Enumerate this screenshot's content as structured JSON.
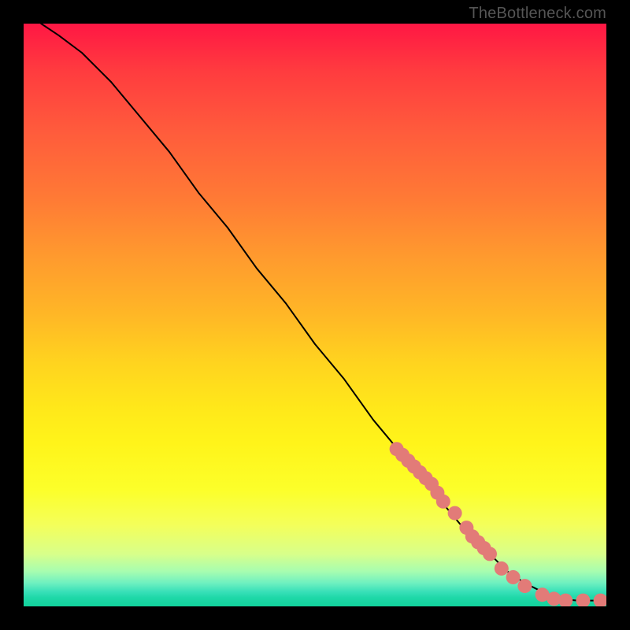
{
  "chart_data": {
    "type": "line",
    "title": "",
    "xlabel": "",
    "ylabel": "",
    "xlim": [
      0,
      100
    ],
    "ylim": [
      0,
      100
    ],
    "grid": false,
    "legend": false,
    "series": [
      {
        "name": "curve",
        "x": [
          3,
          6,
          10,
          15,
          20,
          25,
          30,
          35,
          40,
          45,
          50,
          55,
          60,
          65,
          70,
          75,
          80,
          83,
          86,
          88,
          90,
          92,
          95,
          98
        ],
        "y": [
          100,
          98,
          95,
          90,
          84,
          78,
          71,
          65,
          58,
          52,
          45,
          39,
          32,
          26,
          20,
          14,
          9,
          6,
          4,
          3,
          2,
          1.3,
          1,
          1
        ]
      }
    ],
    "markers": {
      "name": "highlighted-points",
      "color": "#e27b78",
      "radius_px": 9,
      "x": [
        64,
        65,
        66,
        67,
        68,
        69,
        70,
        71,
        72,
        74,
        76,
        77,
        78,
        79,
        80,
        82,
        84,
        86,
        89,
        91,
        93,
        96,
        99
      ],
      "y": [
        27,
        26,
        25,
        24,
        23,
        22,
        21,
        19.5,
        18,
        16,
        13.5,
        12,
        11,
        10,
        9,
        6.5,
        5,
        3.5,
        2,
        1.3,
        1,
        1,
        1
      ]
    }
  },
  "watermark": "TheBottleneck.com"
}
